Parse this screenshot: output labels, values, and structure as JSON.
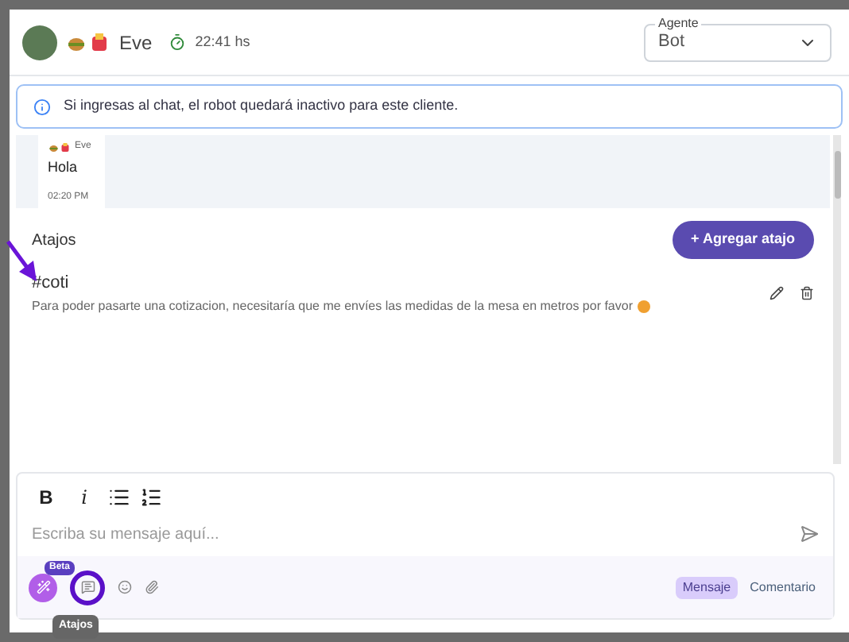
{
  "header": {
    "contact_name": "Eve",
    "timer": "22:41 hs",
    "agent_select": {
      "label": "Agente",
      "value": "Bot"
    }
  },
  "banner": {
    "text": "Si ingresas al chat, el robot quedará inactivo para este cliente."
  },
  "messages": [
    {
      "sender": "Eve",
      "text": "Hola",
      "time": "02:20 PM"
    }
  ],
  "shortcuts": {
    "title": "Atajos",
    "add_button": "+ Agregar atajo",
    "items": [
      {
        "tag": "#coti",
        "text": "Para poder pasarte una cotizacion, necesitaría que me envíes las medidas de la mesa en metros por favor"
      }
    ]
  },
  "editor": {
    "toolbar": [
      {
        "kind": "bold",
        "label": "B"
      },
      {
        "kind": "italic",
        "label": "i"
      },
      {
        "kind": "bullets"
      },
      {
        "kind": "numbers"
      }
    ],
    "placeholder": "Escriba su mensaje aquí...",
    "ai_badge": "Beta",
    "tooltip": "Atajos",
    "modes": [
      {
        "label": "Mensaje",
        "selected": true
      },
      {
        "label": "Comentario",
        "selected": false
      }
    ]
  }
}
